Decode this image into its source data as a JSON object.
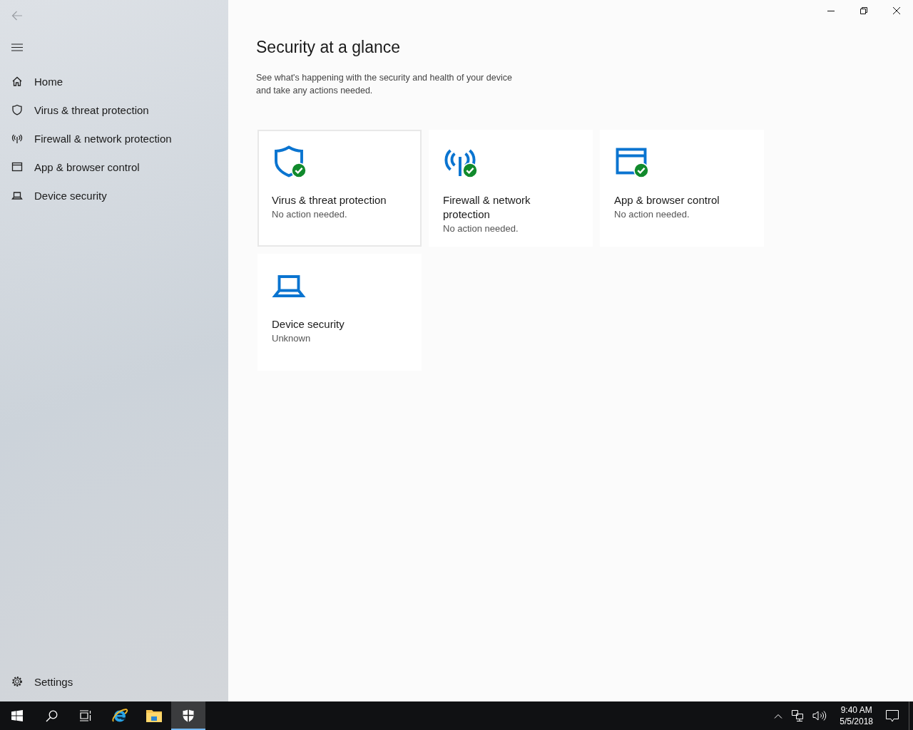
{
  "sidebar": {
    "items": [
      {
        "label": "Home",
        "kind": "home"
      },
      {
        "label": "Virus & threat protection",
        "kind": "shield"
      },
      {
        "label": "Firewall & network protection",
        "kind": "antenna"
      },
      {
        "label": "App & browser control",
        "kind": "window"
      },
      {
        "label": "Device security",
        "kind": "laptop"
      }
    ],
    "settings": {
      "label": "Settings"
    }
  },
  "main": {
    "title": "Security at a glance",
    "description": "See what's happening with the security and health of your device and take any actions needed.",
    "tiles": [
      {
        "kind": "shield",
        "title": "Virus & threat protection",
        "status": "No action needed.",
        "ok": true,
        "selected": true
      },
      {
        "kind": "antenna",
        "title": "Firewall & network protection",
        "status": "No action needed.",
        "ok": true,
        "selected": false
      },
      {
        "kind": "window",
        "title": "App & browser control",
        "status": "No action needed.",
        "ok": true,
        "selected": false
      },
      {
        "kind": "laptop",
        "title": "Device security",
        "status": "Unknown",
        "ok": false,
        "selected": false
      }
    ]
  },
  "taskbar": {
    "apps": [
      {
        "kind": "start",
        "selected": false
      },
      {
        "kind": "search",
        "selected": false
      },
      {
        "kind": "taskview",
        "selected": false
      },
      {
        "kind": "browser",
        "selected": false
      },
      {
        "kind": "folder",
        "selected": false
      },
      {
        "kind": "security",
        "selected": true
      }
    ],
    "time": "9:40 AM",
    "date": "5/5/2018"
  }
}
